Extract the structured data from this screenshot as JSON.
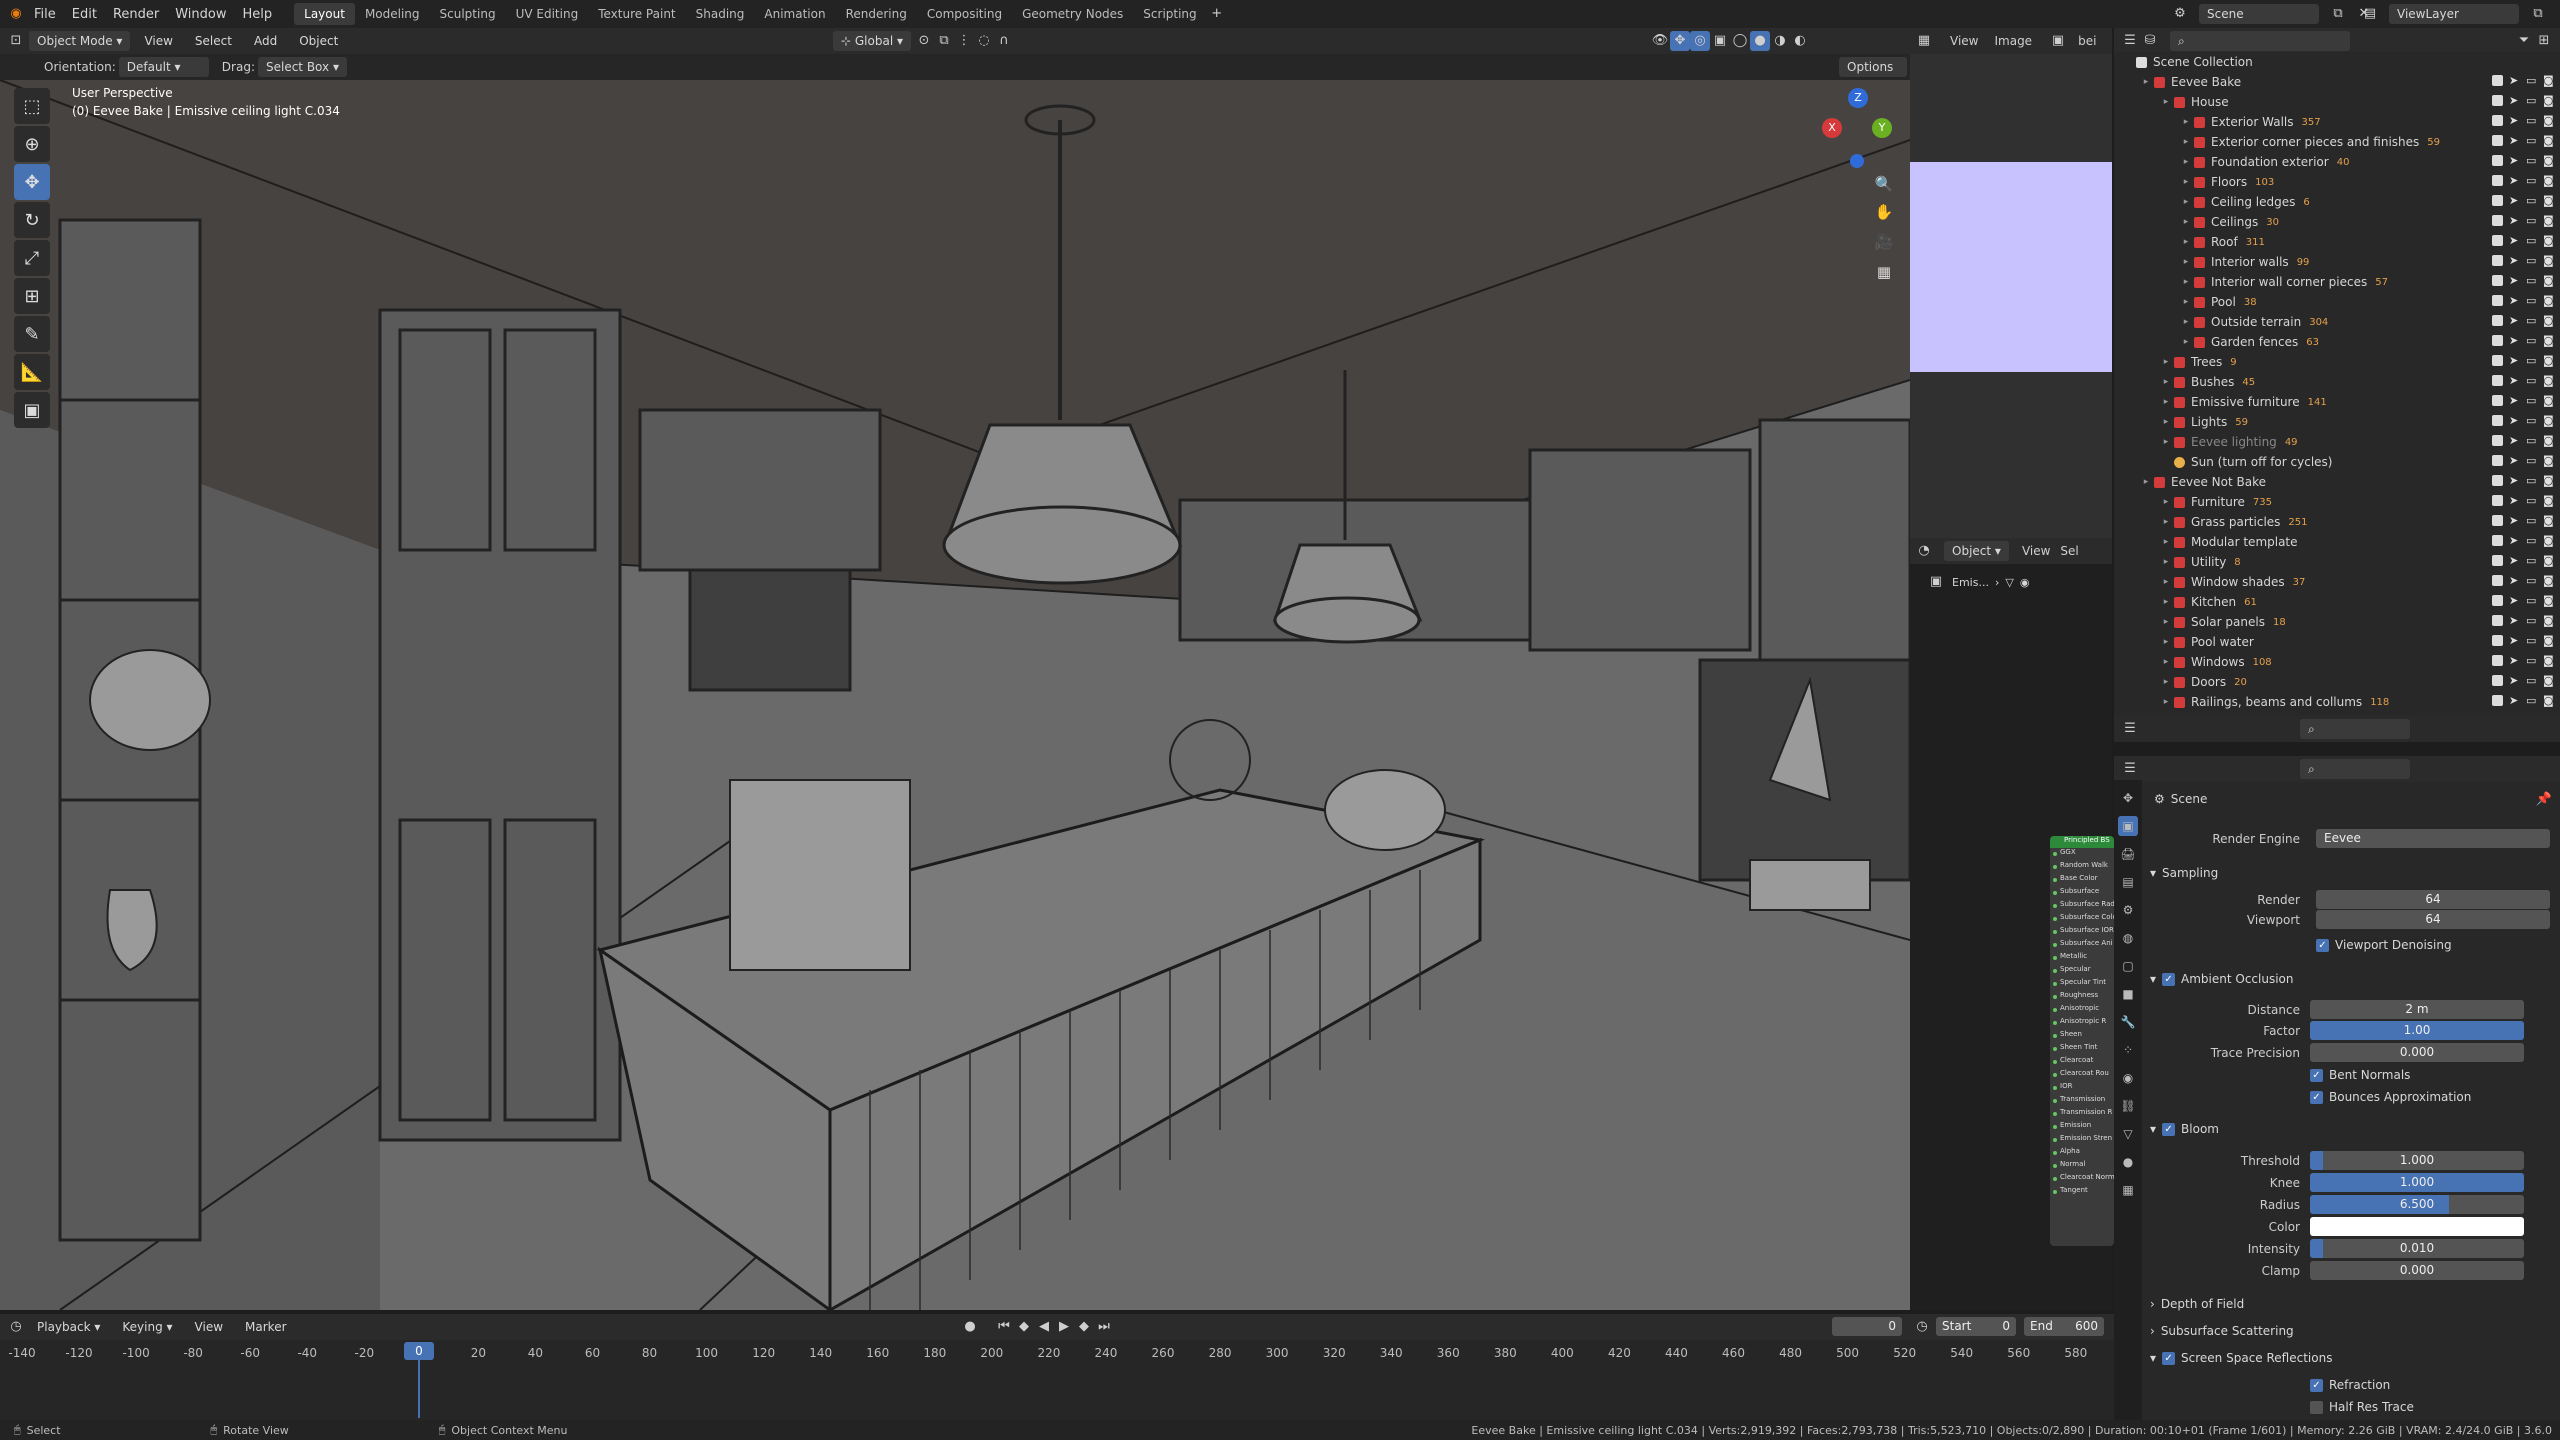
{
  "topbar": {
    "menus": [
      "File",
      "Edit",
      "Render",
      "Window",
      "Help"
    ],
    "workspaces": [
      "Layout",
      "Modeling",
      "Sculpting",
      "UV Editing",
      "Texture Paint",
      "Shading",
      "Animation",
      "Rendering",
      "Compositing",
      "Geometry Nodes",
      "Scripting"
    ],
    "active_workspace": "Layout",
    "scene": "Scene",
    "view_layer": "ViewLayer"
  },
  "viewport_header": {
    "mode": "Object Mode",
    "menus": [
      "View",
      "Select",
      "Add",
      "Object"
    ],
    "transform": "Global",
    "options": "Options"
  },
  "tool_settings": {
    "orientation_label": "Orientation:",
    "orientation_value": "Default",
    "drag_label": "Drag:",
    "drag_value": "Select Box"
  },
  "viewport": {
    "perspective": "User Perspective",
    "object_info": "(0) Eevee Bake | Emissive ceiling light C.034",
    "gizmo_axes": {
      "x": "X",
      "y": "Y",
      "z": "Z"
    }
  },
  "image_editor": {
    "menus": [
      "View",
      "Image"
    ],
    "extra": "bei"
  },
  "node_editor": {
    "mode": "Object",
    "menus": [
      "View",
      "Sel"
    ],
    "breadcrumb": "Emis...",
    "node_title": "Principled BS",
    "sockets": [
      "GGX",
      "Random Walk",
      "Base Color",
      "Subsurface",
      "Subsurface Rad",
      "Subsurface Colo",
      "Subsurface IOR",
      "Subsurface Ani",
      "Metallic",
      "Specular",
      "Specular Tint",
      "Roughness",
      "Anisotropic",
      "Anisotropic R",
      "Sheen",
      "Sheen Tint",
      "Clearcoat",
      "Clearcoat Rou",
      "IOR",
      "Transmission",
      "Transmission R",
      "Emission",
      "Emission Stren",
      "Alpha",
      "Normal",
      "Clearcoat Norm",
      "Tangent"
    ]
  },
  "outliner": {
    "root": "Scene Collection",
    "rows": [
      {
        "label": "Eevee Bake",
        "depth": 0,
        "badge": ""
      },
      {
        "label": "House",
        "depth": 1,
        "badge": ""
      },
      {
        "label": "Exterior Walls",
        "depth": 2,
        "badge": "357"
      },
      {
        "label": "Exterior corner pieces and finishes",
        "depth": 2,
        "badge": "59"
      },
      {
        "label": "Foundation exterior",
        "depth": 2,
        "badge": "40"
      },
      {
        "label": "Floors",
        "depth": 2,
        "badge": "103"
      },
      {
        "label": "Ceiling ledges",
        "depth": 2,
        "badge": "6"
      },
      {
        "label": "Ceilings",
        "depth": 2,
        "badge": "30"
      },
      {
        "label": "Roof",
        "depth": 2,
        "badge": "311"
      },
      {
        "label": "Interior walls",
        "depth": 2,
        "badge": "99"
      },
      {
        "label": "Interior wall corner pieces",
        "depth": 2,
        "badge": "57"
      },
      {
        "label": "Pool",
        "depth": 2,
        "badge": "38"
      },
      {
        "label": "Outside terrain",
        "depth": 2,
        "badge": "304"
      },
      {
        "label": "Garden fences",
        "depth": 2,
        "badge": "63"
      },
      {
        "label": "Trees",
        "depth": 1,
        "badge": "9"
      },
      {
        "label": "Bushes",
        "depth": 1,
        "badge": "45"
      },
      {
        "label": "Emissive furniture",
        "depth": 1,
        "badge": "141"
      },
      {
        "label": "Lights",
        "depth": 1,
        "badge": "59"
      },
      {
        "label": "Eevee lighting",
        "depth": 1,
        "badge": "49"
      },
      {
        "label": "Sun (turn off for cycles)",
        "depth": 1,
        "badge": "",
        "sun": true
      },
      {
        "label": "Eevee Not Bake",
        "depth": 0,
        "badge": ""
      },
      {
        "label": "Furniture",
        "depth": 1,
        "badge": "735"
      },
      {
        "label": "Grass particles",
        "depth": 1,
        "badge": "251"
      },
      {
        "label": "Modular template",
        "depth": 1,
        "badge": ""
      },
      {
        "label": "Utility",
        "depth": 1,
        "badge": "8"
      },
      {
        "label": "Window shades",
        "depth": 1,
        "badge": "37"
      },
      {
        "label": "Kitchen",
        "depth": 1,
        "badge": "61"
      },
      {
        "label": "Solar panels",
        "depth": 1,
        "badge": "18"
      },
      {
        "label": "Pool water",
        "depth": 1,
        "badge": ""
      },
      {
        "label": "Windows",
        "depth": 1,
        "badge": "108"
      },
      {
        "label": "Doors",
        "depth": 1,
        "badge": "20"
      },
      {
        "label": "Railings, beams and collums",
        "depth": 1,
        "badge": "118"
      }
    ]
  },
  "properties": {
    "context": "Scene",
    "render_engine_label": "Render Engine",
    "render_engine": "Eevee",
    "sampling": {
      "title": "Sampling",
      "render_label": "Render",
      "render": "64",
      "viewport_label": "Viewport",
      "viewport": "64",
      "denoise": "Viewport Denoising"
    },
    "ao": {
      "title": "Ambient Occlusion",
      "distance_label": "Distance",
      "distance": "2 m",
      "factor_label": "Factor",
      "factor": "1.00",
      "trace_label": "Trace Precision",
      "trace": "0.000",
      "bent": "Bent Normals",
      "bounces": "Bounces Approximation"
    },
    "bloom": {
      "title": "Bloom",
      "threshold_label": "Threshold",
      "threshold": "1.000",
      "knee_label": "Knee",
      "knee": "1.000",
      "radius_label": "Radius",
      "radius": "6.500",
      "color_label": "Color",
      "color": "#ffffff",
      "intensity_label": "Intensity",
      "intensity": "0.010",
      "clamp_label": "Clamp",
      "clamp": "0.000"
    },
    "dof": "Depth of Field",
    "sss": "Subsurface Scattering",
    "ssr": {
      "title": "Screen Space Reflections",
      "refraction": "Refraction",
      "half_res": "Half Res Trace"
    }
  },
  "timeline": {
    "menus": [
      "Playback",
      "Keying",
      "View",
      "Marker"
    ],
    "current": "0",
    "start_label": "Start",
    "start": "0",
    "end_label": "End",
    "end": "600",
    "ticks": [
      "-140",
      "-120",
      "-100",
      "-80",
      "-60",
      "-40",
      "-20",
      "0",
      "20",
      "40",
      "60",
      "80",
      "100",
      "120",
      "140",
      "160",
      "180",
      "200",
      "220",
      "240",
      "260",
      "280",
      "300",
      "320",
      "340",
      "360",
      "380",
      "400",
      "420",
      "440",
      "460",
      "480",
      "500",
      "520",
      "540",
      "560",
      "580"
    ]
  },
  "status": {
    "select": "Select",
    "rotate": "Rotate View",
    "context": "Object Context Menu",
    "info": "Eevee Bake | Emissive ceiling light C.034 | Verts:2,919,392 | Faces:2,793,738 | Tris:5,523,710 | Objects:0/2,890 | Duration: 00:10+01 (Frame 1/601) | Memory: 2.26 GiB | VRAM: 2.4/24.0 GiB | 3.6.0"
  },
  "colors": {
    "accent": "#4772b3",
    "collection": "#d43b3b",
    "badge": "#e5a04b"
  }
}
